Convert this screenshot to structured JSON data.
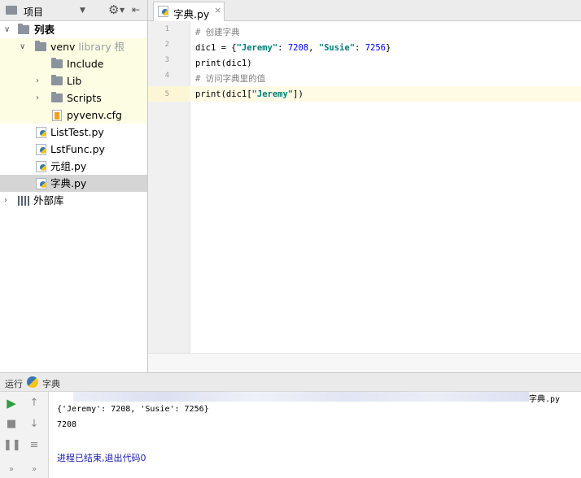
{
  "project_panel": {
    "title": "项目",
    "tree": [
      {
        "label": "列表",
        "type": "root-folder",
        "expanded": true
      },
      {
        "label": "venv",
        "extra": "library 根",
        "type": "folder",
        "expanded": true
      },
      {
        "label": "Include",
        "type": "folder"
      },
      {
        "label": "Lib",
        "type": "folder",
        "collapsed": true
      },
      {
        "label": "Scripts",
        "type": "folder",
        "collapsed": true
      },
      {
        "label": "pyvenv.cfg",
        "type": "cfg-file"
      },
      {
        "label": "ListTest.py",
        "type": "py-file"
      },
      {
        "label": "LstFunc.py",
        "type": "py-file"
      },
      {
        "label": "元组.py",
        "type": "py-file"
      },
      {
        "label": "字典.py",
        "type": "py-file",
        "selected": true
      },
      {
        "label": "外部库",
        "type": "library",
        "collapsed": true
      }
    ]
  },
  "editor": {
    "tab_label": "字典.py",
    "current_line": 5,
    "lines": [
      {
        "n": "1",
        "text": "# 创建字典"
      },
      {
        "n": "2",
        "text": "dic1 = {\"Jeremy\": 7208, \"Susie\": 7256}"
      },
      {
        "n": "3",
        "text": "print(dic1)"
      },
      {
        "n": "4",
        "text": "# 访问字典里的值"
      },
      {
        "n": "5",
        "text": "print(dic1[\"Jeremy\"])"
      }
    ]
  },
  "run_panel": {
    "label": "运行",
    "config_name": "字典",
    "header_tail": "字典.py",
    "output": [
      "{'Jeremy': 7208, 'Susie': 7256}",
      "7208",
      "",
      "进程已结束,退出代码0"
    ]
  },
  "colors": {
    "comment": "#808080",
    "string": "#007f7f",
    "number": "#0000ff",
    "venv_highlight": "#fdfde3",
    "selection": "#d5d5d5",
    "exit_message": "#1a1aaa"
  }
}
